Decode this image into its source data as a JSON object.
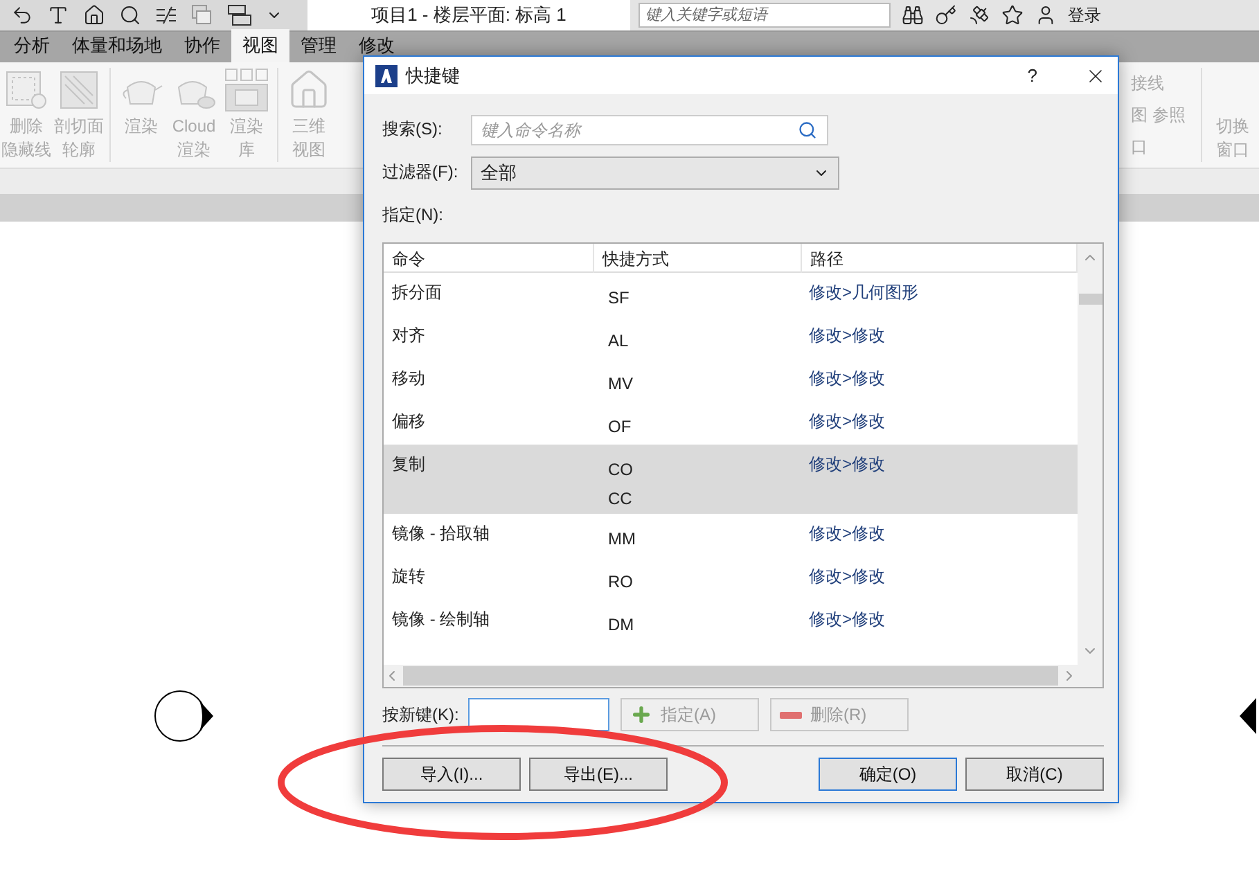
{
  "app_bar": {
    "title": "项目1 - 楼层平面: 标高 1",
    "search": {
      "placeholder": "键入关键字或短语"
    },
    "sign_in": "登录"
  },
  "ribbon_tabs": [
    {
      "label": "分析",
      "selected": false
    },
    {
      "label": "体量和场地",
      "selected": false
    },
    {
      "label": "协作",
      "selected": false
    },
    {
      "label": "视图",
      "selected": true
    },
    {
      "label": "管理",
      "selected": false
    },
    {
      "label": "修改",
      "selected": false
    }
  ],
  "ribbon_tools": [
    {
      "lines": [
        "删除",
        "隐藏线"
      ],
      "kind": "hidden-line",
      "disabled": true
    },
    {
      "lines": [
        "剖切面",
        "轮廓"
      ],
      "kind": "cut-profile",
      "disabled": true
    },
    {
      "lines": [
        "渲染"
      ],
      "kind": "render",
      "disabled": true
    },
    {
      "lines": [
        "Cloud",
        "渲染"
      ],
      "kind": "cloud",
      "disabled": true
    },
    {
      "lines": [
        "渲染",
        "库"
      ],
      "kind": "gallery",
      "disabled": true
    },
    {
      "lines": [
        "三维",
        "视图"
      ],
      "kind": "house",
      "disabled": true
    }
  ],
  "ribbon_right": {
    "rows": [
      "接线",
      "图 参照",
      "口"
    ],
    "switch_window": [
      "切换",
      "窗口"
    ]
  },
  "dialog": {
    "title": "快捷键",
    "help": "?",
    "search": {
      "label": "搜索(S):",
      "placeholder": "键入命令名称"
    },
    "filter": {
      "label": "过滤器(F):",
      "value": "全部"
    },
    "assign_label": "指定(N):",
    "table": {
      "columns": [
        "命令",
        "快捷方式",
        "路径"
      ],
      "rows": [
        {
          "command": "拆分面",
          "shortcuts": [
            "SF"
          ],
          "path": "修改>几何图形",
          "selected": false
        },
        {
          "command": "对齐",
          "shortcuts": [
            "AL"
          ],
          "path": "修改>修改",
          "selected": false
        },
        {
          "command": "移动",
          "shortcuts": [
            "MV"
          ],
          "path": "修改>修改",
          "selected": false
        },
        {
          "command": "偏移",
          "shortcuts": [
            "OF"
          ],
          "path": "修改>修改",
          "selected": false
        },
        {
          "command": "复制",
          "shortcuts": [
            "CO",
            "CC"
          ],
          "path": "修改>修改",
          "selected": true
        },
        {
          "command": "镜像 - 拾取轴",
          "shortcuts": [
            "MM"
          ],
          "path": "修改>修改",
          "selected": false
        },
        {
          "command": "旋转",
          "shortcuts": [
            "RO"
          ],
          "path": "修改>修改",
          "selected": false
        },
        {
          "command": "镜像 - 绘制轴",
          "shortcuts": [
            "DM"
          ],
          "path": "修改>修改",
          "selected": false
        }
      ]
    },
    "new_key": {
      "label": "按新键(K):"
    },
    "key_buttons": [
      {
        "label": "指定(A)",
        "kind": "add",
        "disabled": true
      },
      {
        "label": "删除(R)",
        "kind": "remove",
        "disabled": true
      }
    ],
    "footer_buttons": [
      {
        "label": "导入(I)...",
        "default": false
      },
      {
        "label": "导出(E)...",
        "default": false
      },
      {
        "label": "确定(O)",
        "default": true
      },
      {
        "label": "取消(C)",
        "default": false
      }
    ]
  }
}
